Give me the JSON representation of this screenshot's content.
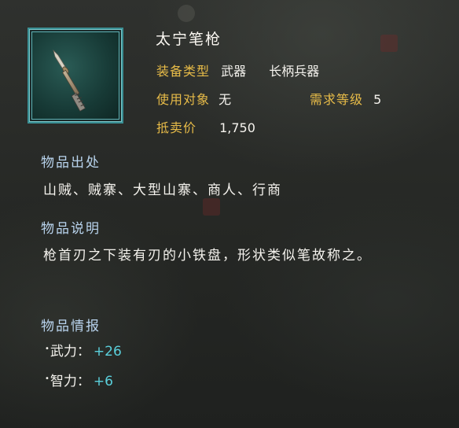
{
  "item": {
    "name": "太宁笔枪",
    "equip_type_label": "装备类型",
    "equip_type_value": "武器",
    "equip_subtype_value": "长柄兵器",
    "user_label": "使用对象",
    "user_value": "无",
    "level_label": "需求等级",
    "level_value": "5",
    "price_label": "抵卖价",
    "price_value": "1,750"
  },
  "source": {
    "title": "物品出处",
    "text": "山贼、贼寨、大型山寨、商人、行商"
  },
  "description": {
    "title": "物品说明",
    "text": "枪首刃之下装有刃的小铁盘，形状类似笔故称之。"
  },
  "info": {
    "title": "物品情报",
    "stats": [
      {
        "label": "武力：",
        "value": "+26"
      },
      {
        "label": "智力：",
        "value": "+6"
      }
    ]
  },
  "icon_name": "spear-icon",
  "colors": {
    "label_gold": "#e7bb48",
    "section_blue": "#b9d4ee",
    "stat_cyan": "#5ad0dc",
    "frame_teal": "#3a8f94"
  }
}
